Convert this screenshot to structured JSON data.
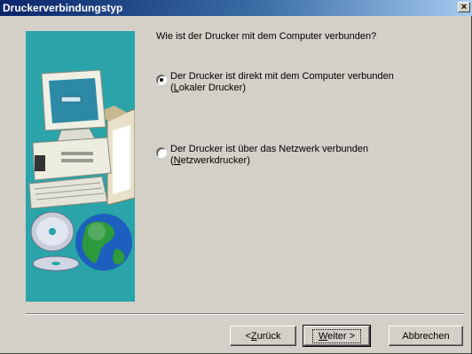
{
  "window": {
    "title": "Druckerverbindungstyp",
    "close_label": "×"
  },
  "main": {
    "question": "Wie ist der Drucker mit dem Computer verbunden?",
    "options": [
      {
        "line1": "Der Drucker ist direkt mit dem Computer verbunden",
        "line2_accel": "L",
        "line2_rest": "okaler Drucker)",
        "line2_prefix": "(",
        "checked": true
      },
      {
        "line1": "Der Drucker ist über das Netzwerk verbunden",
        "line2_accel": "N",
        "line2_rest": "etzwerkdrucker)",
        "line2_prefix": "(",
        "checked": false
      }
    ]
  },
  "buttons": {
    "back_prefix": "< ",
    "back_accel": "Z",
    "back_rest": "urück",
    "next_accel": "W",
    "next_rest": "eiter >",
    "cancel": "Abbrechen"
  },
  "colors": {
    "illustration_bg": "#2aa4a8",
    "titlebar_start": "#0a246a",
    "titlebar_end": "#a6caf0"
  },
  "icons": [
    "computer-illustration",
    "cd-icon",
    "globe-icon",
    "close-icon"
  ]
}
